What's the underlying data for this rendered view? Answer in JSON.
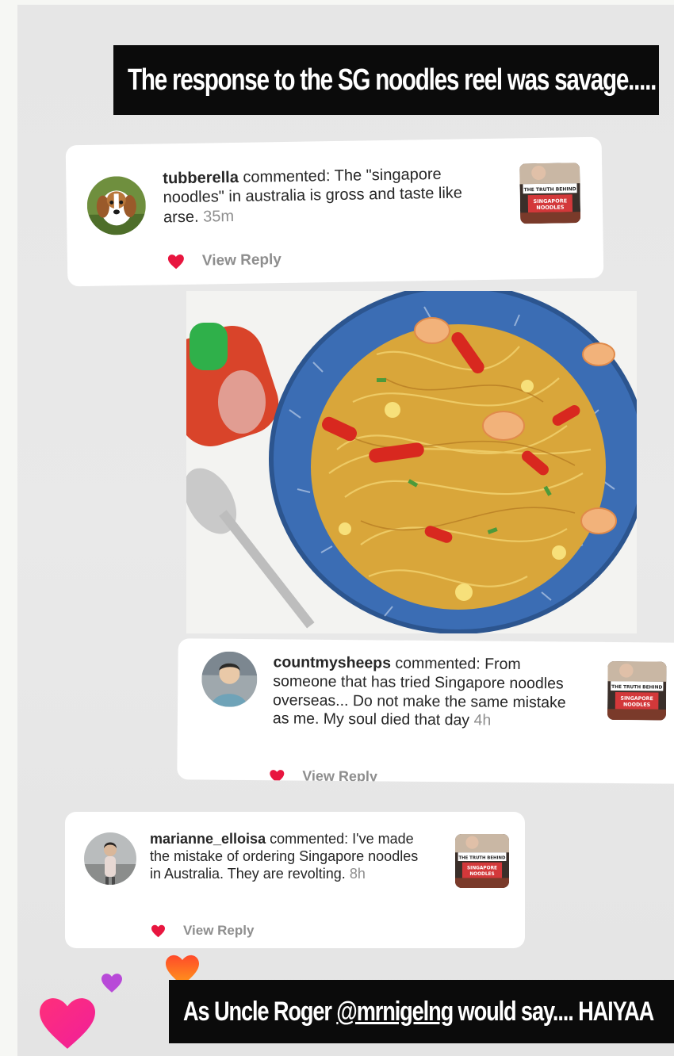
{
  "headline": "The response to the SG noodles reel was savage.....",
  "comments": [
    {
      "username": "tubberella",
      "verb": "commented:",
      "text": "The \"singapore noodles\" in australia is gross and taste like arse.",
      "time": "35m",
      "reply_label": "View Reply",
      "avatar_icon": "beagle-dog-avatar",
      "thumbnail_caption": [
        "THE TRUTH BEHIND",
        "SINGAPORE",
        "NOODLES"
      ]
    },
    {
      "username": "countmysheeps",
      "verb": "commented:",
      "text": "From someone that has tried Singapore noodles overseas... Do not make the same mistake as me. My soul died that day",
      "time": "4h",
      "reply_label": "View Reply",
      "avatar_icon": "person-avatar",
      "thumbnail_caption": [
        "THE TRUTH BEHIND",
        "SINGAPORE",
        "NOODLES"
      ]
    },
    {
      "username": "marianne_elloisa",
      "verb": "commented:",
      "text": "I've made the mistake of ordering Singapore noodles in Australia. They are revolting.",
      "time": "8h",
      "reply_label": "View Reply",
      "avatar_icon": "person-avatar",
      "thumbnail_caption": [
        "THE TRUTH BEHIND",
        "SINGAPORE",
        "NOODLES"
      ]
    }
  ],
  "footer_banner": {
    "prefix": "As Uncle Roger ",
    "mention": "@mrnigelng",
    "suffix": " would say.... HAIYAA"
  },
  "colors": {
    "like_heart": "#e8163f",
    "banner_bg": "#0b0b0b",
    "card_bg": "#ffffff",
    "timestamp": "#8e8e8e",
    "bowl_blue": "#3b6db4"
  }
}
